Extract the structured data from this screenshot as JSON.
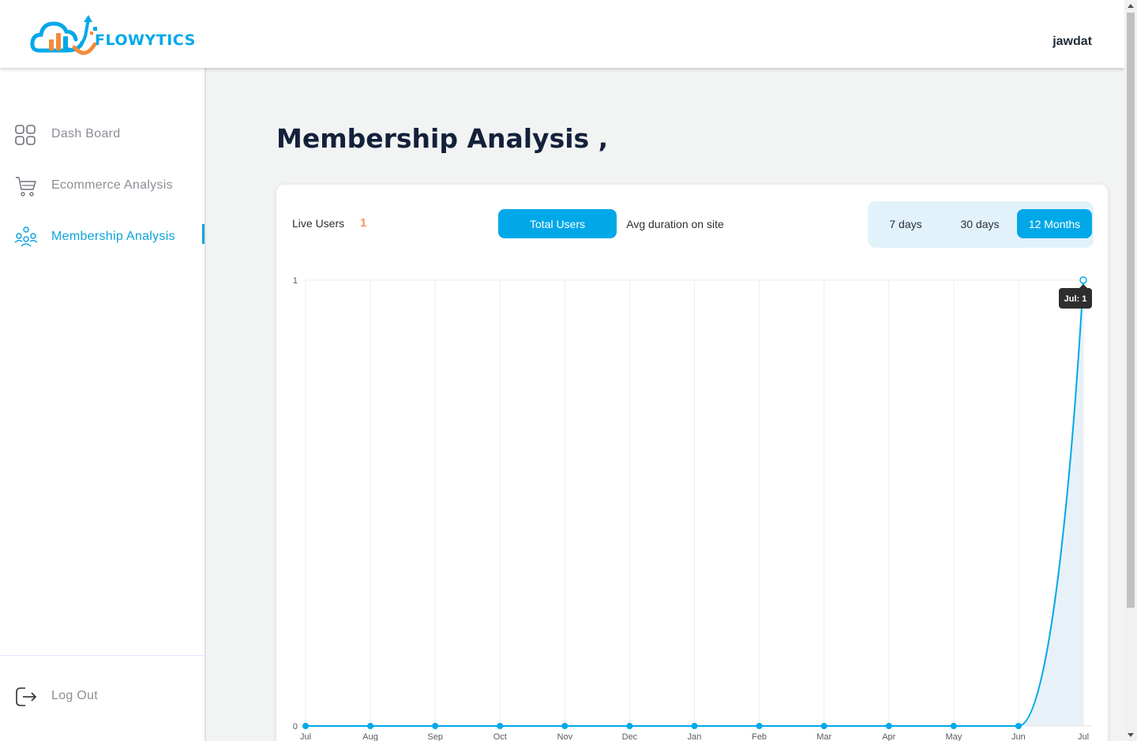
{
  "header": {
    "brand": "FLOWYTICS",
    "username": "jawdat"
  },
  "sidebar": {
    "items": [
      {
        "label": "Dash Board",
        "icon": "grid-icon",
        "active": false
      },
      {
        "label": "Ecommerce Analysis",
        "icon": "cart-icon",
        "active": false
      },
      {
        "label": "Membership Analysis",
        "icon": "users-icon",
        "active": true
      }
    ],
    "logout_label": "Log Out"
  },
  "page": {
    "title": "Membership Analysis ,"
  },
  "card": {
    "live_users_label": "Live Users",
    "live_users_value": "1",
    "metric_tabs": [
      {
        "label": "Total Users",
        "active": true
      },
      {
        "label": "Avg duration on site",
        "active": false
      }
    ],
    "ranges": [
      {
        "label": "7 days",
        "active": false
      },
      {
        "label": "30 days",
        "active": false
      },
      {
        "label": "12 Months",
        "active": true
      }
    ],
    "tooltip": "Jul: 1"
  },
  "colors": {
    "accent": "#00a8e8",
    "live_value": "#f29461",
    "area_fill": "#e8f1f7"
  },
  "chart_data": {
    "type": "area",
    "categories": [
      "Jul",
      "Aug",
      "Sep",
      "Oct",
      "Nov",
      "Dec",
      "Jan",
      "Feb",
      "Mar",
      "Apr",
      "May",
      "Jun",
      "Jul"
    ],
    "series": [
      {
        "values": [
          0,
          0,
          0,
          0,
          0,
          0,
          0,
          0,
          0,
          0,
          0,
          0,
          1
        ]
      }
    ],
    "y_ticks": [
      "0",
      "1"
    ],
    "ylim": [
      0,
      1
    ],
    "grid": true
  }
}
